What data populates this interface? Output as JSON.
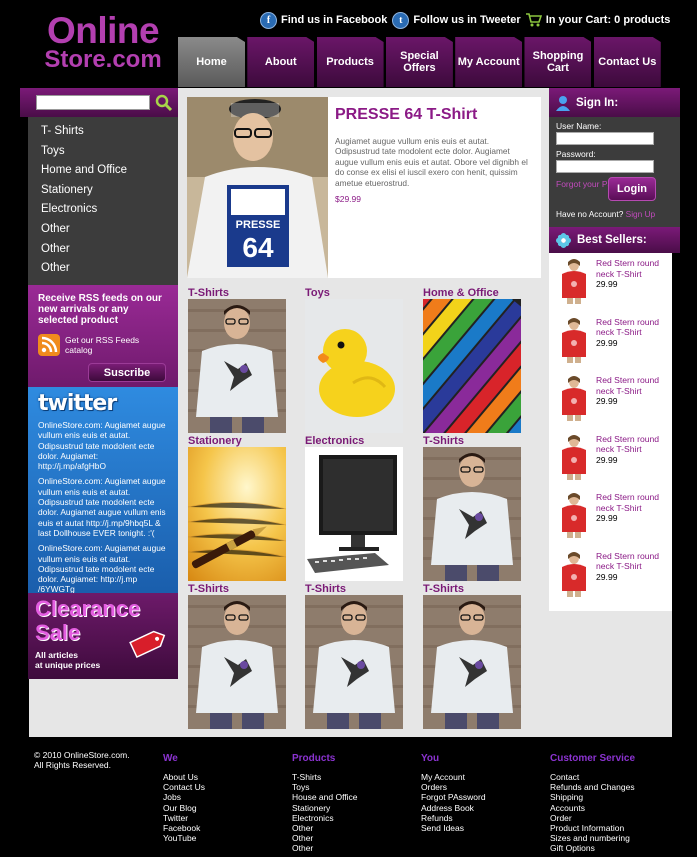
{
  "brand": {
    "line1": "Online",
    "line2": "Store.com"
  },
  "toplinks": {
    "facebook": "Find us in Facebook",
    "twitter": "Follow us in Tweeter",
    "cart": "In your Cart: 0 products"
  },
  "nav": [
    "Home",
    "About",
    "Products",
    "Special Offers",
    "My Account",
    "Shopping Cart",
    "Contact Us"
  ],
  "categories": [
    "T- Shirts",
    "Toys",
    "Home and Office",
    "Stationery",
    "Electronics",
    "Other",
    "Other",
    "Other"
  ],
  "rss": {
    "title": "Receive RSS feeds on our new arrivals or any selected product",
    "link": "Get our RSS Feeds catalog",
    "button": "Suscribe"
  },
  "twitter": {
    "logo": "twitter",
    "tweets": [
      "OnlineStore.com: Augiamet augue vullum enis euis et autat. Odipsustrud tate modolent ecte dolor. Augiamet: http://j.mp/afgHbO",
      "OnlineStore.com: Augiamet augue vullum enis euis et autat. Odipsustrud tate modolent ecte dolor. Augiamet augue vullum enis euis et autat http://j.mp/9hbq5L & last Dollhouse EVER tonight. :'(",
      "OnlineStore.com: Augiamet augue vullum enis euis et autat. Odipsustrud tate modolent ecte dolor. Augiamet: http://j.mp /6YWGTg"
    ]
  },
  "clearance": {
    "line1": "Clearance",
    "line2": "Sale",
    "sub1": "All articles",
    "sub2": "at unique prices"
  },
  "feature": {
    "title": "PRESSE 64 T-Shirt",
    "desc": "Augiamet augue vullum enis euis et autat. Odipsustrud tate modolent ecte dolor. Augiamet augue vullum enis euis et autat. Obore vel dignibh el do conse ex elisi el iuscil exero con henit, quissim ametue etuerostrud.",
    "price": "$29.99",
    "shirt_text1": "PRESSE",
    "shirt_text2": "64"
  },
  "grid": [
    {
      "title": "T-Shirts",
      "kind": "man"
    },
    {
      "title": "Toys",
      "kind": "duck"
    },
    {
      "title": "Home & Office",
      "kind": "pencils"
    },
    {
      "title": "Stationery",
      "kind": "pen"
    },
    {
      "title": "Electronics",
      "kind": "monitor"
    },
    {
      "title": "T-Shirts",
      "kind": "man"
    },
    {
      "title": "T-Shirts",
      "kind": "man"
    },
    {
      "title": "T-Shirts",
      "kind": "man"
    },
    {
      "title": "T-Shirts",
      "kind": "man"
    }
  ],
  "signin": {
    "title": "Sign In:",
    "user_label": "User Name:",
    "pass_label": "Password:",
    "forgot": "Forgot your Password?",
    "login": "Login",
    "noacct": "Have no Account?",
    "signup": "Sign Up"
  },
  "bestsellers": {
    "title": "Best Sellers:",
    "items": [
      {
        "name": "Red Stern round neck T-Shirt",
        "price": "29.99"
      },
      {
        "name": "Red Stern round neck T-Shirt",
        "price": "29.99"
      },
      {
        "name": "Red Stern round neck T-Shirt",
        "price": "29.99"
      },
      {
        "name": "Red Stern round neck T-Shirt",
        "price": "29.99"
      },
      {
        "name": "Red Stern round neck T-Shirt",
        "price": "29.99"
      },
      {
        "name": "Red Stern round neck T-Shirt",
        "price": "29.99"
      }
    ]
  },
  "footer": {
    "copy1": "© 2010 OnlineStore.com.",
    "copy2": "All Rights Reserved.",
    "cols": [
      {
        "title": "We",
        "links": [
          "About Us",
          "Contact Us",
          "Jobs",
          "Our Blog",
          "Twitter",
          "Facebook",
          "YouTube"
        ]
      },
      {
        "title": "Products",
        "links": [
          "T-Shirts",
          "Toys",
          "House and Office",
          "Stationery",
          "Electronics",
          "Other",
          "Other",
          "Other"
        ]
      },
      {
        "title": "You",
        "links": [
          "My Account",
          "Orders",
          "Forgot PAssword",
          "Address Book",
          "Refunds",
          "Send Ideas"
        ]
      },
      {
        "title": "Customer Service",
        "links": [
          "Contact",
          "Refunds and Changes",
          "Shipping",
          "Accounts",
          "Order",
          "Product Information",
          "Sizes and numbering",
          "Gift Options"
        ]
      }
    ]
  },
  "colors": {
    "purple": "#8b1a86",
    "dark_purple": "#4a0d48",
    "footer_heading": "#8b33d0",
    "twitter_blue": "#2f8be0"
  }
}
